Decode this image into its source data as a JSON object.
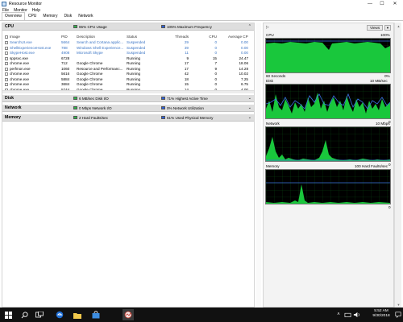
{
  "window": {
    "title": "Resource Monitor",
    "controls": {
      "minimize": "—",
      "maximize": "☐",
      "close": "✕"
    }
  },
  "menu": [
    "File",
    "Monitor",
    "Help"
  ],
  "tabs": [
    "Overview",
    "CPU",
    "Memory",
    "Disk",
    "Network"
  ],
  "active_tab": "Overview",
  "sections": {
    "cpu": {
      "title": "CPU",
      "usage": "65% CPU Usage",
      "freq": "105% Maximum Frequency"
    },
    "disk": {
      "title": "Disk",
      "io": "6 MB/sec Disk I/O",
      "active": "71% Highest Active Time"
    },
    "network": {
      "title": "Network",
      "io": "0 Mbps Network I/O",
      "util": "0% Network Utilization"
    },
    "memory": {
      "title": "Memory",
      "faults": "2 Hard Faults/sec",
      "used": "61% Used Physical Memory"
    }
  },
  "process_table": {
    "columns": [
      "Image",
      "PID",
      "Description",
      "Status",
      "Threads",
      "CPU",
      "Average CPU"
    ],
    "rows": [
      {
        "image": "SearchUI.exe",
        "pid": "5664",
        "desc": "Search and Cortana applic...",
        "status": "Suspended",
        "threads": "29",
        "cpu": "0",
        "avg": "0.00",
        "suspended": true
      },
      {
        "image": "ShellExperienceHost.exe",
        "pid": "788",
        "desc": "Windows Shell Experience...",
        "status": "Suspended",
        "threads": "39",
        "cpu": "0",
        "avg": "0.00",
        "suspended": true
      },
      {
        "image": "SkypeHost.exe",
        "pid": "4908",
        "desc": "Microsoft Skype",
        "status": "Suspended",
        "threads": "11",
        "cpu": "0",
        "avg": "0.00",
        "suspended": true
      },
      {
        "image": "sppsvc.exe",
        "pid": "6728",
        "desc": "",
        "status": "Running",
        "threads": "9",
        "cpu": "15",
        "avg": "24.47",
        "suspended": false
      },
      {
        "image": "chrome.exe",
        "pid": "712",
        "desc": "Google Chrome",
        "status": "Running",
        "threads": "17",
        "cpu": "7",
        "avg": "18.06",
        "suspended": false
      },
      {
        "image": "perfmon.exe",
        "pid": "1060",
        "desc": "Resource and Performanc...",
        "status": "Running",
        "threads": "17",
        "cpu": "9",
        "avg": "14.28",
        "suspended": false
      },
      {
        "image": "chrome.exe",
        "pid": "5616",
        "desc": "Google Chrome",
        "status": "Running",
        "threads": "42",
        "cpu": "0",
        "avg": "10.02",
        "suspended": false
      },
      {
        "image": "chrome.exe",
        "pid": "5884",
        "desc": "Google Chrome",
        "status": "Running",
        "threads": "18",
        "cpu": "0",
        "avg": "7.25",
        "suspended": false
      },
      {
        "image": "chrome.exe",
        "pid": "3684",
        "desc": "Google Chrome",
        "status": "Running",
        "threads": "15",
        "cpu": "0",
        "avg": "6.75",
        "suspended": false
      },
      {
        "image": "chrome.exe",
        "pid": "5744",
        "desc": "Google Chrome",
        "status": "Running",
        "threads": "14",
        "cpu": "0",
        "avg": "4.00",
        "suspended": false
      }
    ]
  },
  "right_pane": {
    "views_label": "Views",
    "expand_icon": "chevron-right-icon",
    "graphs": {
      "cpu": {
        "title": "CPU",
        "max": "100%",
        "time": "60 Seconds",
        "min": "0%"
      },
      "disk": {
        "title": "Disk",
        "max": "10 MB/sec",
        "min": "0"
      },
      "network": {
        "title": "Network",
        "max": "10 Mbps",
        "min": "0"
      },
      "memory": {
        "title": "Memory",
        "max": "100 Hard Faults/sec",
        "min": "0"
      }
    }
  },
  "taskbar": {
    "time": "5:52 AM",
    "date": "9/30/2018",
    "icons": [
      "windows-start-icon",
      "search-icon",
      "task-view-icon",
      "edge-icon",
      "file-explorer-icon",
      "store-icon",
      "resource-monitor-icon"
    ]
  },
  "colors": {
    "graph_bg": "#000000",
    "graph_green": "#19c73c",
    "graph_blue": "#3b6fe0",
    "suspended_text": "#3a74c4",
    "section_header": "#dedede"
  }
}
